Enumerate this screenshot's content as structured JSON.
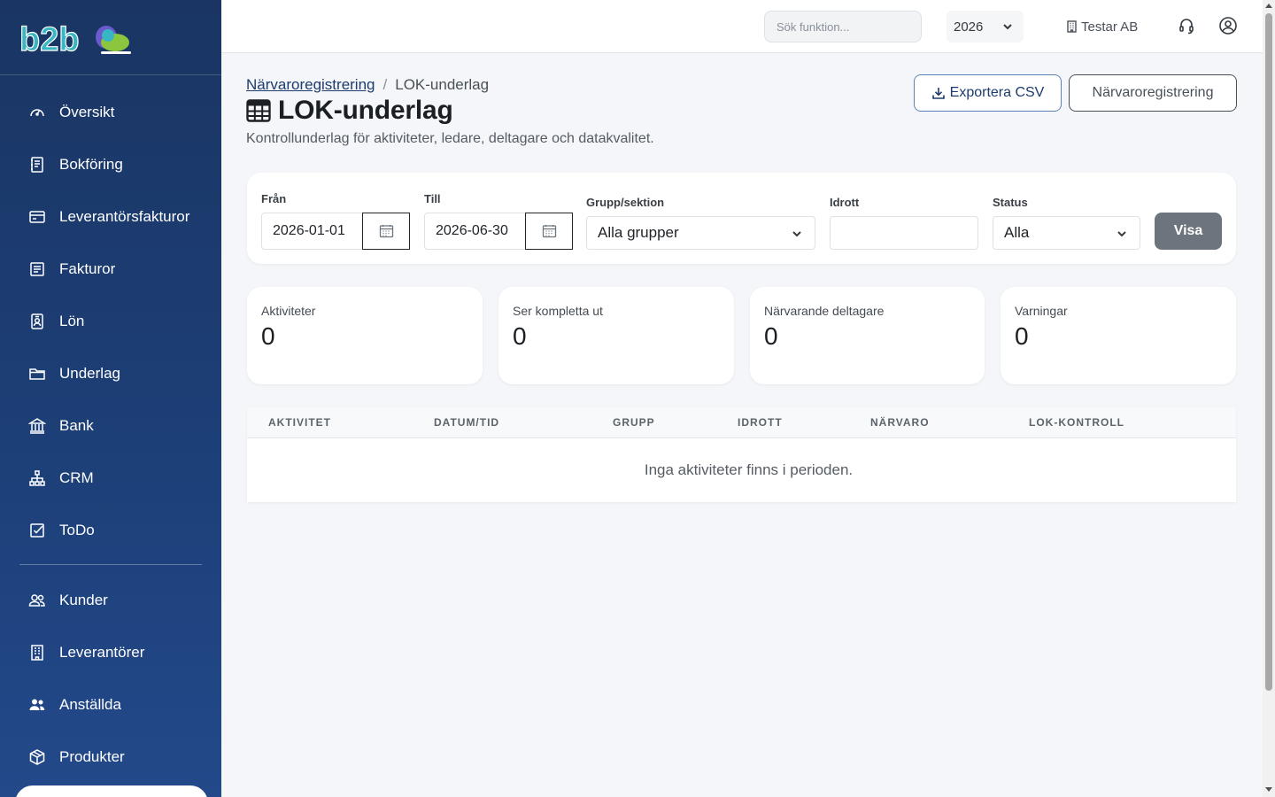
{
  "app": {
    "logo_text": "b2b",
    "brand_colors": {
      "sidebar": "#1d4079",
      "primary": "#1c3b6e",
      "logo_teal": "#38b6c4",
      "logo_green": "#8cc63f",
      "logo_purple": "#6a5acd"
    }
  },
  "sidebar": {
    "items": [
      {
        "label": "Översikt",
        "icon": "speedometer-icon"
      },
      {
        "label": "Bokföring",
        "icon": "journal-icon"
      },
      {
        "label": "Leverantörsfakturor",
        "icon": "credit-card-icon"
      },
      {
        "label": "Fakturor",
        "icon": "receipt-icon"
      },
      {
        "label": "Lön",
        "icon": "person-badge-icon"
      },
      {
        "label": "Underlag",
        "icon": "folder-icon"
      },
      {
        "label": "Bank",
        "icon": "bank-icon"
      },
      {
        "label": "CRM",
        "icon": "diagram-icon"
      },
      {
        "label": "ToDo",
        "icon": "check-square-icon"
      }
    ],
    "items2": [
      {
        "label": "Kunder",
        "icon": "people-icon"
      },
      {
        "label": "Leverantörer",
        "icon": "building-icon"
      },
      {
        "label": "Anställda",
        "icon": "people-fill-icon"
      },
      {
        "label": "Produkter",
        "icon": "box-icon"
      }
    ]
  },
  "topbar": {
    "search_placeholder": "Sök funktion...",
    "year": "2026",
    "company": "Testar AB",
    "icons": [
      "headset-icon",
      "user-circle-icon"
    ]
  },
  "page": {
    "breadcrumb_parent": "Närvaroregistrering",
    "breadcrumb_sep": "/",
    "breadcrumb_current": "LOK-underlag",
    "title": "LOK-underlag",
    "subtitle": "Kontrollunderlag för aktiviteter, ledare, deltagare och datakvalitet.",
    "export_label": "Exportera CSV",
    "narvaro_label": "Närvaroregistrering"
  },
  "filters": {
    "from_label": "Från",
    "from_value": "2026-01-01",
    "to_label": "Till",
    "to_value": "2026-06-30",
    "group_label": "Grupp/sektion",
    "group_value": "Alla grupper",
    "sport_label": "Idrott",
    "sport_value": "",
    "status_label": "Status",
    "status_value": "Alla",
    "submit_label": "Visa"
  },
  "stats": [
    {
      "label": "Aktiviteter",
      "value": "0"
    },
    {
      "label": "Ser kompletta ut",
      "value": "0"
    },
    {
      "label": "Närvarande deltagare",
      "value": "0"
    },
    {
      "label": "Varningar",
      "value": "0"
    }
  ],
  "table": {
    "columns": [
      "AKTIVITET",
      "DATUM/TID",
      "GRUPP",
      "IDROTT",
      "NÄRVARO",
      "LOK-KONTROLL"
    ],
    "empty_message": "Inga aktiviteter finns i perioden."
  }
}
